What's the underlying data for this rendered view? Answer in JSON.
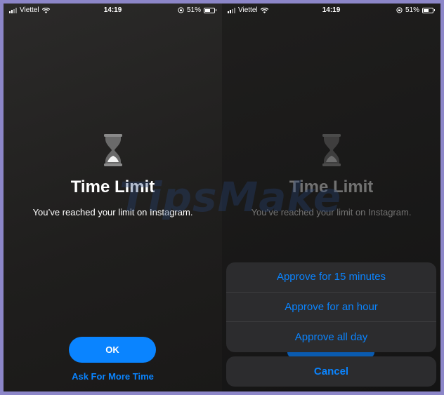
{
  "status": {
    "carrier": "Viettel",
    "time": "14:19",
    "battery": "51%"
  },
  "screen": {
    "title": "Time Limit",
    "message": "You’ve reached your limit on Instagram.",
    "ok_label": "OK",
    "ask_more_label": "Ask For More Time"
  },
  "sheet": {
    "options": [
      "Approve for 15 minutes",
      "Approve for an hour",
      "Approve all day"
    ],
    "cancel_label": "Cancel"
  },
  "watermark": "TipsMake",
  "colors": {
    "accent": "#0a84ff",
    "frame": "#8c86c8"
  }
}
